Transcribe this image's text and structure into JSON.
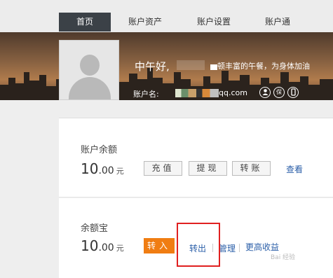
{
  "nav": {
    "tabs": [
      {
        "label": "首页",
        "active": true
      },
      {
        "label": "账户资产",
        "active": false
      },
      {
        "label": "账户设置",
        "active": false
      },
      {
        "label": "账户通",
        "active": false
      }
    ]
  },
  "profile": {
    "greeting": "中午好,",
    "greeting_sub": "顿丰富的午餐，为身体加油",
    "account_label": "账户名:",
    "account_domain": "qq.com",
    "icons": [
      "user-icon",
      "protect-icon",
      "phone-icon"
    ],
    "protect_glyph": "保"
  },
  "balance": {
    "title": "账户余额",
    "amount_int": "10",
    "amount_dec": ".00",
    "unit": "元",
    "buttons": [
      "充值",
      "提现",
      "转账"
    ],
    "view_link": "查看"
  },
  "yuebao": {
    "title": "余额宝",
    "amount_int": "10",
    "amount_dec": ".00",
    "unit": "元",
    "transfer_in": "转入",
    "transfer_out": "转出",
    "manage": "管理",
    "more_income": "更高收益"
  },
  "colors": {
    "nav_active": "#3b4147",
    "orange": "#f07d12",
    "link": "#2a5ea8",
    "highlight": "#e02020"
  }
}
